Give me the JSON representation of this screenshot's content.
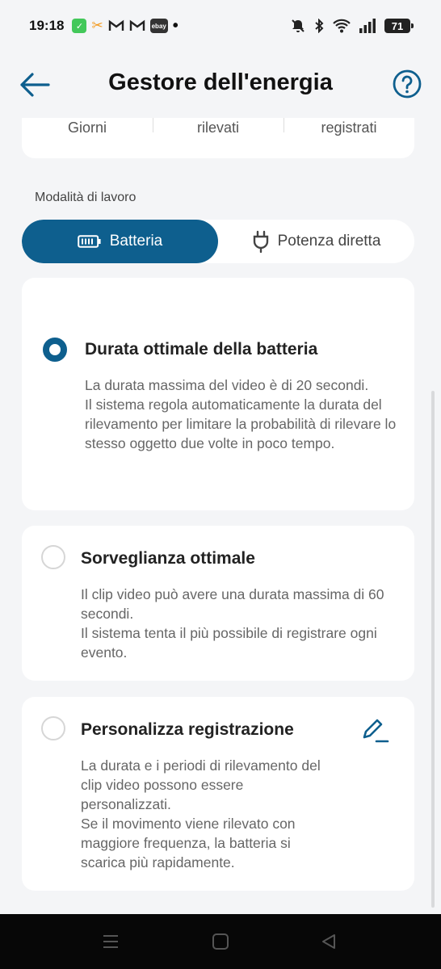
{
  "status_bar": {
    "time": "19:18",
    "battery_level": "71",
    "notification_icons": [
      "whatsapp-icon",
      "app-icon",
      "gmail-icon",
      "gmail-icon",
      "ebay-icon",
      "dot-icon"
    ],
    "system_icons": [
      "mute-icon",
      "bluetooth-icon",
      "wifi-icon",
      "signal-icon",
      "battery-icon"
    ]
  },
  "header": {
    "title": "Gestore dell'energia",
    "back_icon": "arrow-left-icon",
    "help_icon": "question-circle-icon"
  },
  "stats": {
    "items": [
      "Giorni",
      "rilevati",
      "registrati"
    ]
  },
  "work_mode": {
    "label": "Modalità di lavoro",
    "options": [
      {
        "label": "Batteria",
        "icon": "battery-icon",
        "active": true
      },
      {
        "label": "Potenza diretta",
        "icon": "plug-icon",
        "active": false
      }
    ]
  },
  "options": [
    {
      "title": "Durata ottimale della batteria",
      "selected": true,
      "desc1": "La durata massima del video è di 20 secondi.",
      "desc2": "Il sistema regola automaticamente la durata del rilevamento per limitare la probabilità di rilevare lo stesso oggetto due volte in poco tempo."
    },
    {
      "title": "Sorveglianza ottimale",
      "selected": false,
      "desc1": "Il clip video può avere una durata massima di 60 secondi.",
      "desc2": "Il sistema tenta il più possibile di registrare ogni evento."
    },
    {
      "title": "Personalizza registrazione",
      "selected": false,
      "edit_icon": "edit-icon",
      "desc1": "La durata e i periodi di rilevamento del clip video possono essere personalizzati.",
      "desc2": "Se il movimento viene rilevato con maggiore frequenza, la batteria si scarica più rapidamente."
    }
  ],
  "colors": {
    "accent": "#0e5f8e",
    "background": "#f4f5f7",
    "card": "#ffffff"
  },
  "nav_bar": {
    "buttons": [
      "menu-icon",
      "home-icon",
      "back-triangle-icon"
    ]
  }
}
